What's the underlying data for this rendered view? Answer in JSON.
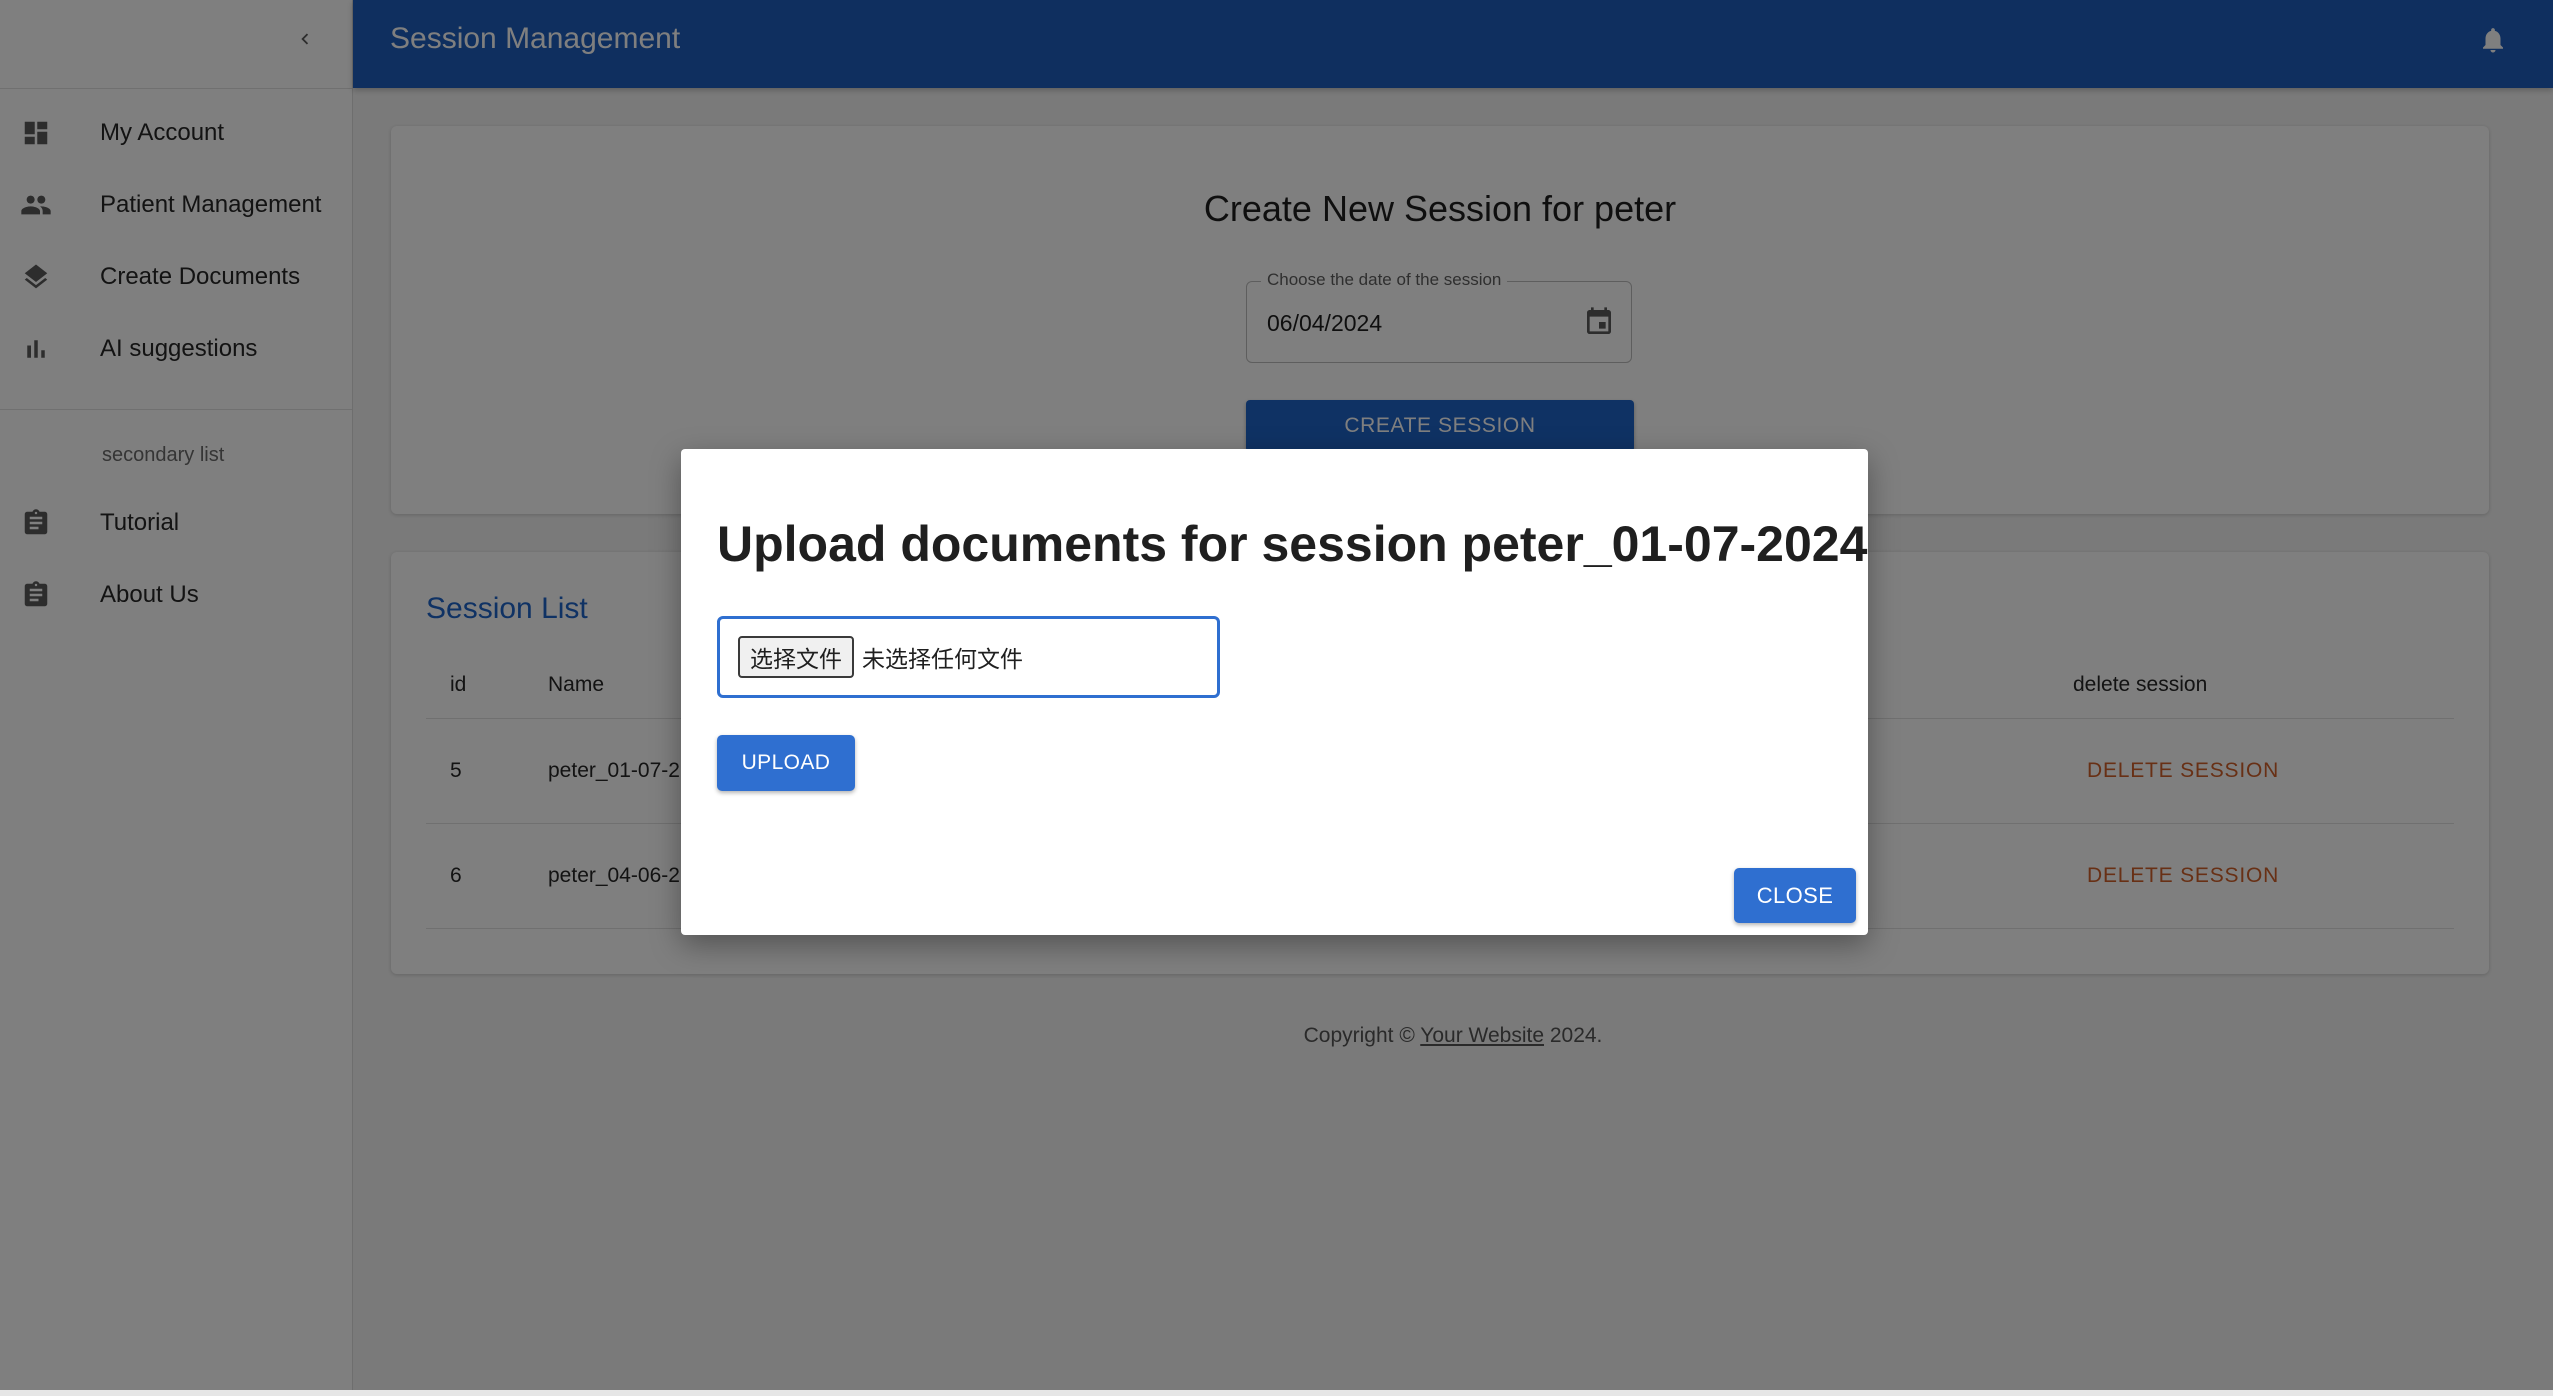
{
  "app": {
    "title": "Session Management"
  },
  "sidebar": {
    "items": [
      {
        "label": "My Account",
        "icon": "dashboard-icon"
      },
      {
        "label": "Patient Management",
        "icon": "people-icon"
      },
      {
        "label": "Create Documents",
        "icon": "layers-icon"
      },
      {
        "label": "AI suggestions",
        "icon": "bar-chart-icon"
      }
    ],
    "secondary_header": "secondary list",
    "secondary_items": [
      {
        "label": "Tutorial",
        "icon": "clipboard-icon"
      },
      {
        "label": "About Us",
        "icon": "clipboard-icon"
      }
    ]
  },
  "create": {
    "title": "Create New Session for peter",
    "date_label": "Choose the date of the session",
    "date_value": "06/04/2024",
    "button": "CREATE SESSION"
  },
  "sessions": {
    "title": "Session List",
    "columns": {
      "id": "id",
      "name": "Name",
      "delete": "delete session"
    },
    "rows": [
      {
        "id": "5",
        "name": "peter_01-07-2",
        "action": "DELETE SESSION"
      },
      {
        "id": "6",
        "name": "peter_04-06-2",
        "action": "DELETE SESSION"
      }
    ]
  },
  "footer": {
    "prefix": "Copyright © ",
    "link": "Your Website",
    "suffix": " 2024."
  },
  "dialog": {
    "title": "Upload documents for session peter_01-07-2024",
    "file_button": "选择文件",
    "file_status": "未选择任何文件",
    "upload": "UPLOAD",
    "close": "CLOSE"
  },
  "colors": {
    "primary": "#1f5fbf",
    "button": "#2f6fd0",
    "danger": "#d0602a"
  }
}
